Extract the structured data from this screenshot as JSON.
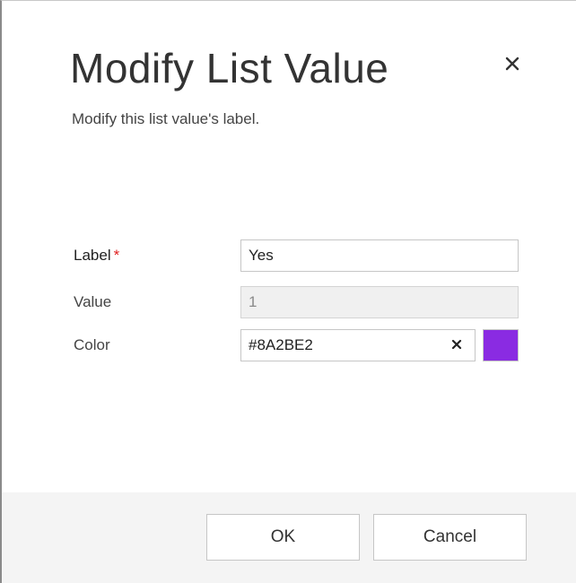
{
  "dialog": {
    "title": "Modify List Value",
    "subtitle": "Modify this list value's label."
  },
  "form": {
    "label": {
      "caption": "Label",
      "required_marker": "*",
      "value": "Yes"
    },
    "value": {
      "caption": "Value",
      "value": "1"
    },
    "color": {
      "caption": "Color",
      "value": "#8A2BE2",
      "swatch_color": "#8A2BE2"
    }
  },
  "footer": {
    "ok_label": "OK",
    "cancel_label": "Cancel"
  },
  "icons": {
    "close": "close-icon",
    "clear": "clear-icon"
  },
  "colors": {
    "required": "#E02020",
    "footer_background": "#F4F4F4"
  }
}
